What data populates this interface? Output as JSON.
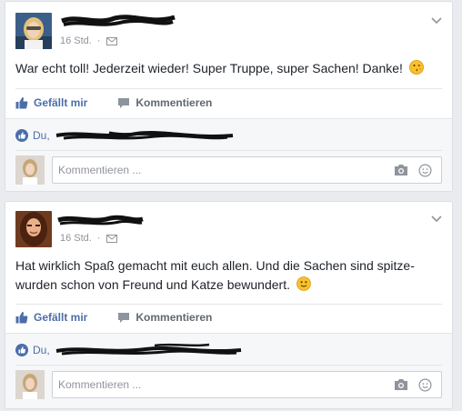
{
  "posts": [
    {
      "timestamp": "16 Std.",
      "text": "War echt toll! Jederzeit wieder! Super Truppe, super Sachen! Danke!",
      "emoji": "winking-kiss-emoji",
      "like_label": "Gefällt mir",
      "comment_label": "Kommentieren",
      "likers_prefix": "Du,",
      "comment_placeholder": "Kommentieren ..."
    },
    {
      "timestamp": "16 Std.",
      "text": "Hat wirklich Spaß gemacht mit euch allen. Und die Sachen sind spitze- wurden schon von Freund und Katze bewundert.",
      "emoji": "smile-emoji",
      "like_label": "Gefällt mir",
      "comment_label": "Kommentieren",
      "likers_prefix": "Du,",
      "comment_placeholder": "Kommentieren ..."
    }
  ],
  "colors": {
    "background": "#e9ebee",
    "link_blue": "#4b6ea9",
    "meta_gray": "#90949c",
    "emoji_yellow": "#f7c02c"
  },
  "icons": [
    "chevron-down-icon",
    "privacy-envelope-icon",
    "thumbs-up-icon",
    "comment-bubble-icon",
    "like-badge-icon",
    "camera-icon",
    "emoji-icon"
  ]
}
